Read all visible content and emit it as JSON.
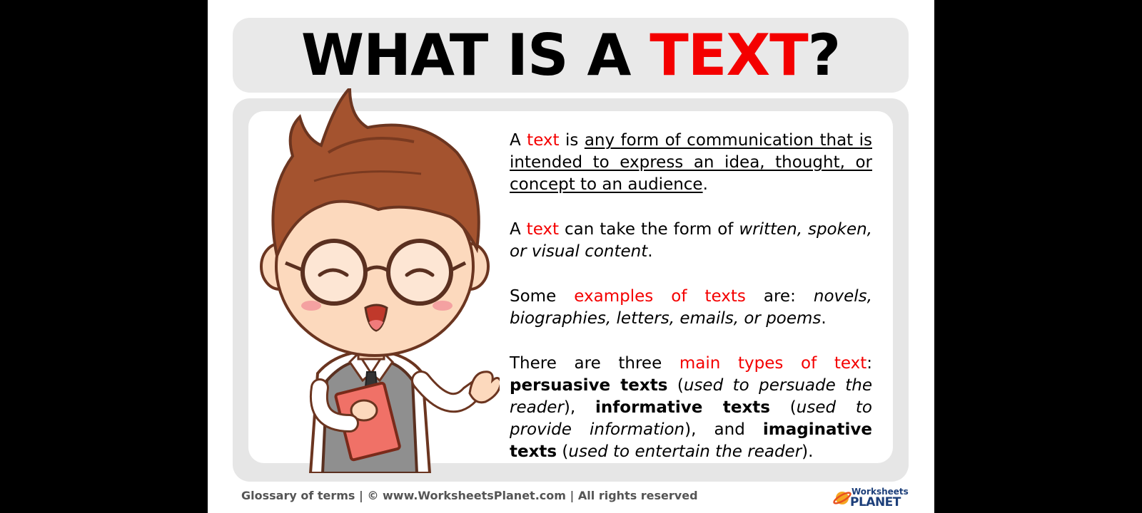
{
  "title": {
    "prefix": "WHAT IS A ",
    "accent": "TEXT",
    "suffix": "?"
  },
  "content": {
    "p1": {
      "a": "A ",
      "b": "text",
      "c": " is ",
      "d": "any form of communication that is intended to express an idea, thought, or concept to an audience",
      "e": "."
    },
    "p2": {
      "a": "A ",
      "b": "text",
      "c": " can take the form of ",
      "d": "written, spoken, or visual content",
      "e": "."
    },
    "p3": {
      "a": "Some ",
      "b": "examples of texts",
      "c": " are: ",
      "d": "novels, biographies, letters, emails, or poems",
      "e": "."
    },
    "p4": {
      "a": "There are three ",
      "b": "main types of text",
      "c": ": ",
      "d": "persuasive texts",
      "e": " (",
      "f": "used to persuade the reader",
      "g": "), ",
      "h": "informative texts",
      "i": " (",
      "j": "used to provide information",
      "k": "), and ",
      "l": "imaginative texts",
      "m": " (",
      "n": "used to entertain the reader",
      "o": ")."
    }
  },
  "footer": {
    "text": "Glossary of terms  |  © www.WorksheetsPlanet.com | All rights reserved"
  },
  "logo": {
    "line1": "Worksheets",
    "line2": "PLANET"
  },
  "colors": {
    "accent": "#f40000",
    "panel": "#e6e6e6",
    "logo": "#1d3f7a",
    "hair": "#a4532f"
  }
}
